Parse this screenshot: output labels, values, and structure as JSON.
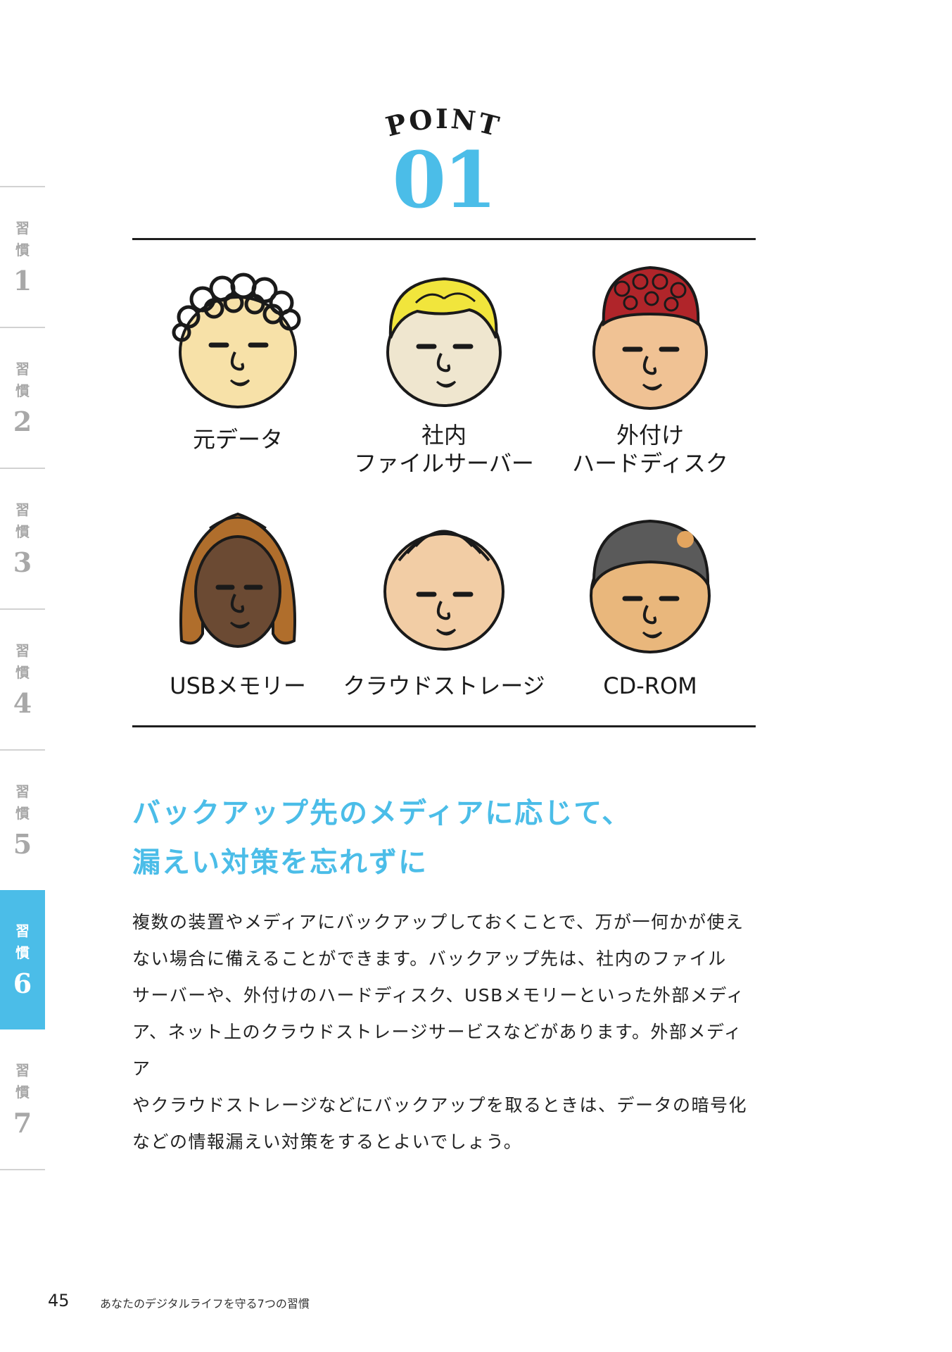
{
  "sidebar": {
    "tabs": [
      {
        "chars": [
          "習",
          "慣"
        ],
        "num": "1",
        "active": false
      },
      {
        "chars": [
          "習",
          "慣"
        ],
        "num": "2",
        "active": false
      },
      {
        "chars": [
          "習",
          "慣"
        ],
        "num": "3",
        "active": false
      },
      {
        "chars": [
          "習",
          "慣"
        ],
        "num": "4",
        "active": false
      },
      {
        "chars": [
          "習",
          "慣"
        ],
        "num": "5",
        "active": false
      },
      {
        "chars": [
          "習",
          "慣"
        ],
        "num": "6",
        "active": true
      },
      {
        "chars": [
          "習",
          "慣"
        ],
        "num": "7",
        "active": false
      }
    ],
    "accent": "#4bbde8"
  },
  "header": {
    "point_word": "POINT",
    "point_number": "01"
  },
  "faces": [
    {
      "label": [
        "元データ"
      ],
      "hair": "curly-black",
      "hair_color": "#1a1a1a",
      "skin": "#f7e1a8"
    },
    {
      "label": [
        "社内",
        "ファイルサーバー"
      ],
      "hair": "blond",
      "hair_color": "#f1e53c",
      "skin": "#efe6cf"
    },
    {
      "label": [
        "外付け",
        "ハードディスク"
      ],
      "hair": "curly-red",
      "hair_color": "#b0252a",
      "skin": "#f0c294"
    },
    {
      "label": [
        "USBメモリー"
      ],
      "hair": "long-brown",
      "hair_color": "#b06e2c",
      "skin": "#6b4a33"
    },
    {
      "label": [
        "クラウドストレージ"
      ],
      "hair": "balding",
      "hair_color": "#f0c9a0",
      "skin": "#f2cda5"
    },
    {
      "label": [
        "CD-ROM"
      ],
      "hair": "short-gray",
      "hair_color": "#5a5a5a",
      "skin": "#e9b77c"
    }
  ],
  "heading": {
    "line1": "バックアップ先のメディアに応じて、",
    "line2": "漏えい対策を忘れずに"
  },
  "body": {
    "lines": [
      "複数の装置やメディアにバックアップしておくことで、万が一何かが使え",
      "ない場合に備えることができます。バックアップ先は、社内のファイル",
      "サーバーや、外付けのハードディスク、USBメモリーといった外部メディ",
      "ア、ネット上のクラウドストレージサービスなどがあります。外部メディア",
      "やクラウドストレージなどにバックアップを取るときは、データの暗号化",
      "などの情報漏えい対策をするとよいでしょう。"
    ]
  },
  "footer": {
    "page_number": "45",
    "running_title": "あなたのデジタルライフを守る7つの習慣"
  }
}
